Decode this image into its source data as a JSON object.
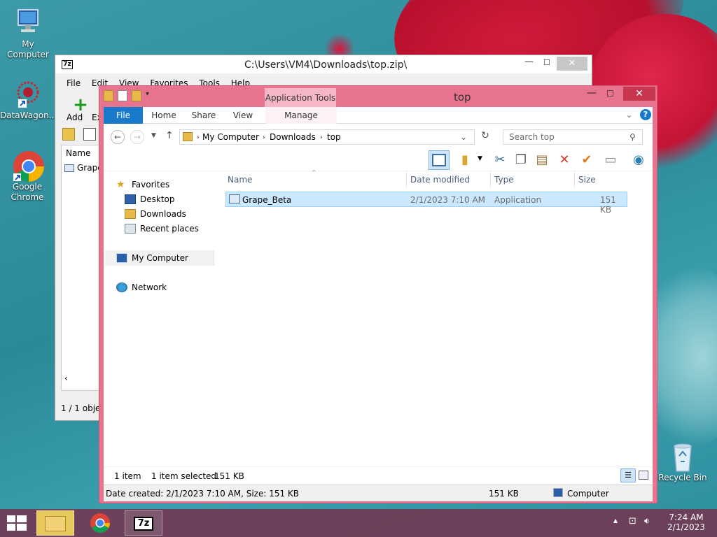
{
  "desktop": {
    "icons": [
      {
        "label": "My Computer"
      },
      {
        "label": "DataWagon..."
      },
      {
        "label": "Google\nChrome"
      },
      {
        "label": "Recycle Bin"
      }
    ]
  },
  "sevenzip": {
    "title": "C:\\Users\\VM4\\Downloads\\top.zip\\",
    "app_icon": "7z",
    "menu": [
      "File",
      "Edit",
      "View",
      "Favorites",
      "Tools",
      "Help"
    ],
    "add_label": "Add",
    "extract_label_partial": "Ex",
    "col_name": "Name",
    "row_partial": "Grape",
    "status": "1 / 1 objec"
  },
  "explorer": {
    "title": "top",
    "app_tools_label": "Application Tools",
    "ribbon_tabs": {
      "file": "File",
      "home": "Home",
      "share": "Share",
      "view": "View",
      "manage": "Manage"
    },
    "breadcrumbs": [
      "My Computer",
      "Downloads",
      "top"
    ],
    "search_placeholder": "Search top",
    "nav": {
      "favorites": "Favorites",
      "desktop": "Desktop",
      "downloads": "Downloads",
      "recent": "Recent places",
      "my_computer": "My Computer",
      "network": "Network"
    },
    "columns": {
      "name": "Name",
      "date": "Date modified",
      "type": "Type",
      "size": "Size"
    },
    "files": [
      {
        "name": "Grape_Beta",
        "date": "2/1/2023 7:10 AM",
        "type": "Application",
        "size": "151 KB"
      }
    ],
    "status": {
      "count": "1 item",
      "selected": "1 item selected",
      "size": "151 KB"
    },
    "details_bar": {
      "created": "Date created: 2/1/2023 7:10 AM, Size: 151 KB",
      "size": "151 KB",
      "location": "Computer"
    }
  },
  "taskbar": {
    "clock_time": "7:24 AM",
    "clock_date": "2/1/2023"
  },
  "colors": {
    "explorer_frame": "#e8738f",
    "ribbon_file": "#1979ca",
    "selection": "#cce8ff",
    "close_button": "#c6374f"
  }
}
